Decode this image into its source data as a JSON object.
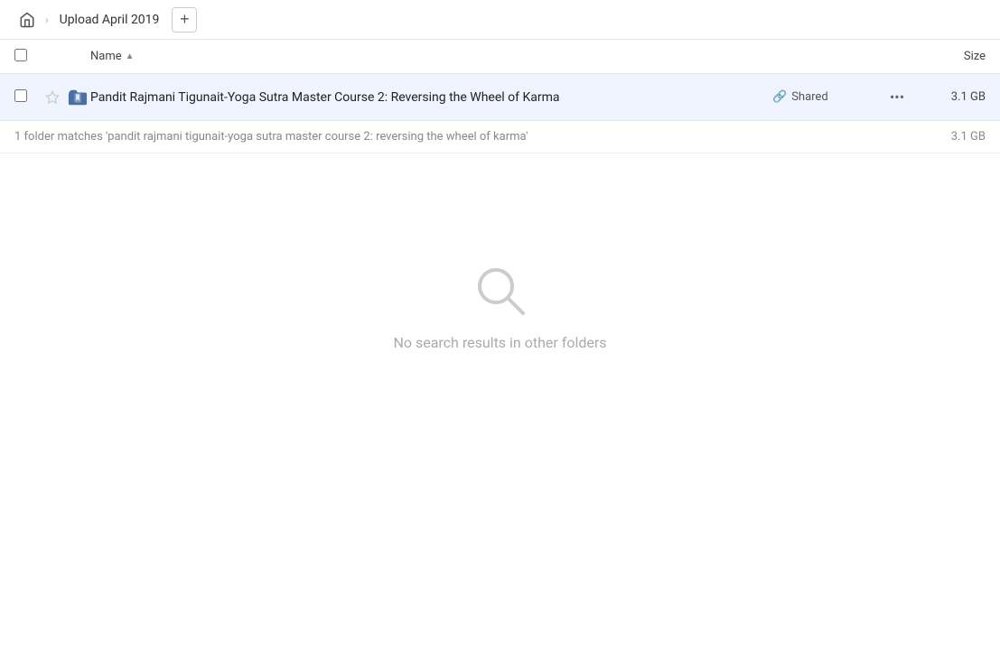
{
  "header": {
    "home_title": "Home",
    "breadcrumb": "Upload April 2019",
    "add_button_label": "+"
  },
  "table": {
    "col_name_label": "Name",
    "col_size_label": "Size",
    "sort_arrow": "▲"
  },
  "file_row": {
    "name": "Pandit Rajmani Tigunait-Yoga Sutra Master Course 2: Reversing the Wheel of Karma",
    "shared_label": "Shared",
    "size": "3.1 GB",
    "more_icon": "•••"
  },
  "match_row": {
    "text": "1 folder matches 'pandit rajmani tigunait-yoga sutra master course 2: reversing the wheel of karma'",
    "size": "3.1 GB"
  },
  "empty_state": {
    "label": "No search results in other folders"
  }
}
